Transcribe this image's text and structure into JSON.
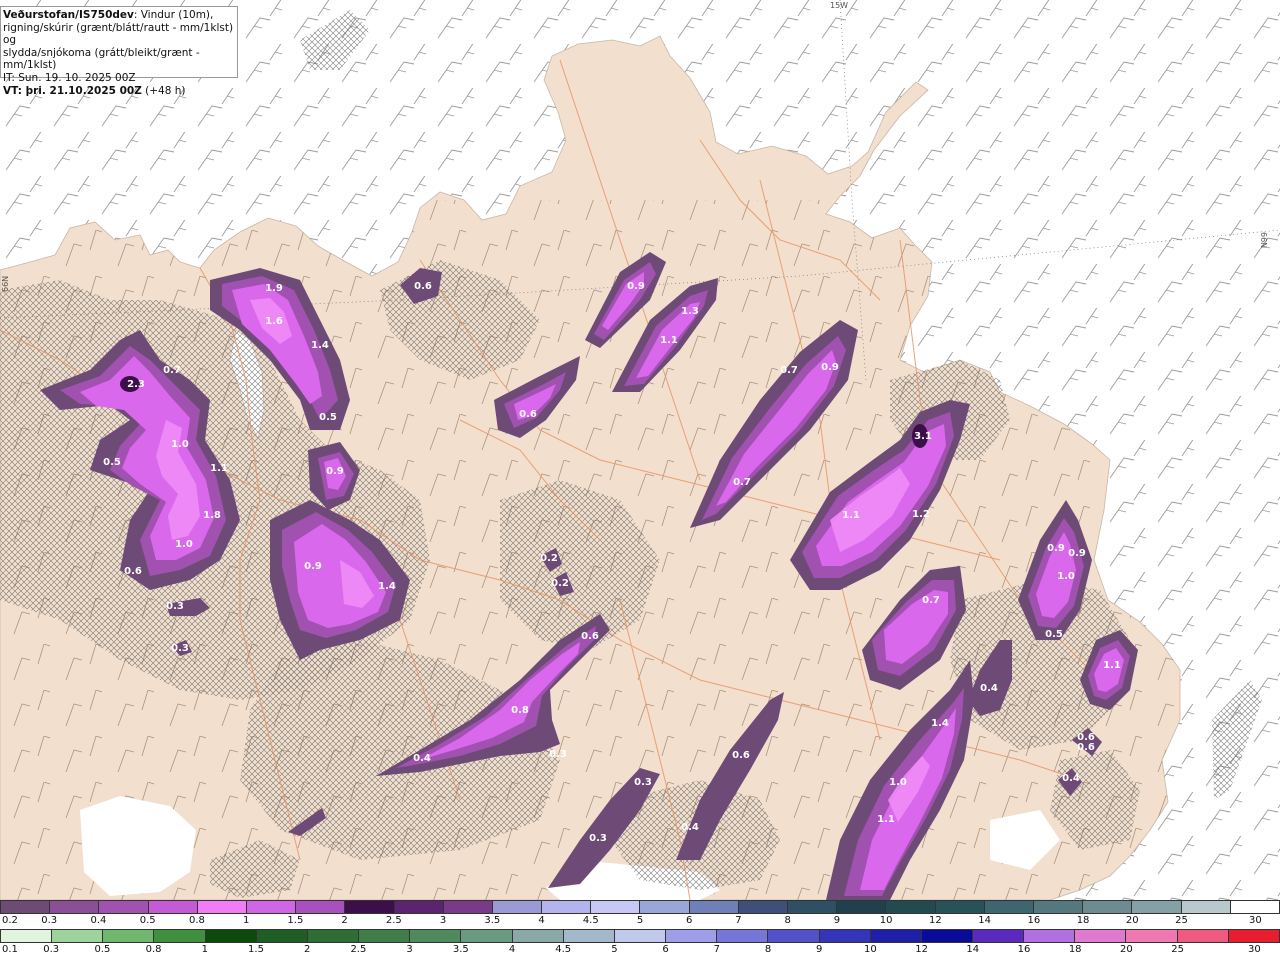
{
  "info": {
    "source": "Veðurstofan/IS750dev",
    "line1_rest": ": Vindur (10m),",
    "line2": "rigning/skúrir (grænt/blátt/rautt - mm/1klst) og",
    "line3": "slydda/snjókoma (grátt/bleikt/grænt - mm/1klst)",
    "it": "IT: Sun. 19. 10. 2025 00Z",
    "vt": "VT: þri. 21.10.2025 00Z",
    "vt_suffix": " (+48 h)"
  },
  "grid_labels": {
    "top": "15W",
    "left": "66N",
    "right": "66N"
  },
  "colors": {
    "sea": "#ffffff",
    "land": "#f2dfcd",
    "roads": "#e89466",
    "precip_light": "#6e4a76",
    "precip_mid": "#a151b0",
    "precip_strong": "#da68ec",
    "precip_peak": "#f08cf8",
    "precip_max": "#3d0f4a"
  },
  "map_labels": [
    {
      "text": "1.9"
    },
    {
      "text": "1.6"
    },
    {
      "text": "1.4"
    },
    {
      "text": "0.5"
    },
    {
      "text": "2.3"
    },
    {
      "text": "0.7"
    },
    {
      "text": "1.0"
    },
    {
      "text": "0.5"
    },
    {
      "text": "1.1"
    },
    {
      "text": "1.8"
    },
    {
      "text": "1.0"
    },
    {
      "text": "0.6"
    },
    {
      "text": "0.3"
    },
    {
      "text": "0.3"
    },
    {
      "text": "0.6"
    },
    {
      "text": "0.9"
    },
    {
      "text": "0.9"
    },
    {
      "text": "1.4"
    },
    {
      "text": "0.6"
    },
    {
      "text": "0.9"
    },
    {
      "text": "1.3"
    },
    {
      "text": "1.1"
    },
    {
      "text": "0.7"
    },
    {
      "text": "0.9"
    },
    {
      "text": "0.7"
    },
    {
      "text": "3.1"
    },
    {
      "text": "1.1"
    },
    {
      "text": "1.2"
    },
    {
      "text": "0.2"
    },
    {
      "text": "0.2"
    },
    {
      "text": "0.6"
    },
    {
      "text": "0.8"
    },
    {
      "text": "0.3"
    },
    {
      "text": "0.4"
    },
    {
      "text": "0.7"
    },
    {
      "text": "0.6"
    },
    {
      "text": "1.4"
    },
    {
      "text": "1.0"
    },
    {
      "text": "1.1"
    },
    {
      "text": "0.3"
    },
    {
      "text": "0.3"
    },
    {
      "text": "0.4"
    },
    {
      "text": "0.6"
    },
    {
      "text": "0.9"
    },
    {
      "text": "0.9"
    },
    {
      "text": "1.0"
    },
    {
      "text": "0.5"
    },
    {
      "text": "1.1"
    },
    {
      "text": "0.6"
    },
    {
      "text": "0.4"
    },
    {
      "text": "0.4"
    }
  ],
  "legend_snow": {
    "labels": [
      "0.2",
      "0.3",
      "0.4",
      "0.5",
      "0.8",
      "1",
      "1.5",
      "2",
      "2.5",
      "3",
      "3.5",
      "4",
      "4.5",
      "5",
      "6",
      "7",
      "8",
      "9",
      "10",
      "12",
      "14",
      "16",
      "18",
      "20",
      "25",
      "30"
    ],
    "colors": [
      "#6e4a76",
      "#8a4f96",
      "#a151b0",
      "#c45ad6",
      "#f07df7",
      "#d066e6",
      "#a850bd",
      "#3d0f4a",
      "#5c2470",
      "#7a3a8a",
      "#9a9ad6",
      "#b3b3ee",
      "#c8c8f7",
      "#9aa6d8",
      "#6f7fb8",
      "#3e4f7a",
      "#2f4f64",
      "#20404e",
      "#234a50",
      "#28525a",
      "#3e6670",
      "#55787f",
      "#6c8c92",
      "#86a1a6",
      "#b9c8cc",
      "#ffffff"
    ]
  },
  "legend_rain": {
    "labels": [
      "0.1",
      "0.3",
      "0.5",
      "0.8",
      "1",
      "1.5",
      "2",
      "2.5",
      "3",
      "3.5",
      "4",
      "4.5",
      "5",
      "6",
      "7",
      "8",
      "9",
      "10",
      "12",
      "14",
      "16",
      "18",
      "20",
      "25",
      "30"
    ],
    "colors": [
      "#dff5df",
      "#9ed39e",
      "#6fb66f",
      "#3e8f3e",
      "#0b4a0b",
      "#1e5e24",
      "#2e6e36",
      "#3f7d4a",
      "#4f8a5e",
      "#6a9a80",
      "#8aa8a8",
      "#a4b8cc",
      "#c0c8ec",
      "#9d9de8",
      "#7676d8",
      "#5252c8",
      "#3434b8",
      "#1e1ea8",
      "#0a0a98",
      "#5a2ac0",
      "#b070e0",
      "#e07ad0",
      "#f078b0",
      "#f05a80",
      "#e81e30"
    ]
  }
}
